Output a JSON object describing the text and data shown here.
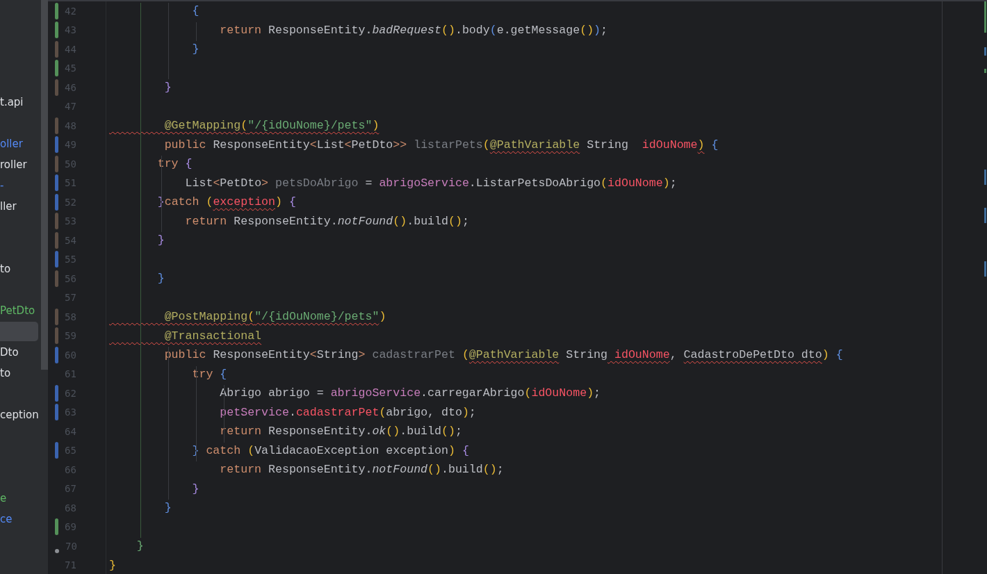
{
  "project_tree": {
    "items": [
      {
        "kind": "blank",
        "selected": false
      },
      {
        "kind": "blank",
        "selected": false
      },
      {
        "kind": "blank",
        "selected": false
      },
      {
        "kind": "blank",
        "selected": false
      },
      {
        "kind": "text",
        "label": "t.api",
        "color": "#dfe1e5",
        "selected": false
      },
      {
        "kind": "blank",
        "selected": false
      },
      {
        "kind": "text",
        "label": "oller",
        "color": "#548af7",
        "selected": false
      },
      {
        "kind": "text",
        "label": "roller",
        "color": "#dfe1e5",
        "selected": false
      },
      {
        "kind": "text",
        "label": "-",
        "color": "#548af7",
        "selected": false
      },
      {
        "kind": "text",
        "label": "ller",
        "color": "#dfe1e5",
        "selected": false
      },
      {
        "kind": "blank",
        "selected": false
      },
      {
        "kind": "blank",
        "selected": false
      },
      {
        "kind": "text",
        "label": "to",
        "color": "#dfe1e5",
        "selected": false
      },
      {
        "kind": "blank",
        "selected": false
      },
      {
        "kind": "text",
        "label": "PetDto",
        "color": "#5fb865",
        "selected": false
      },
      {
        "kind": "blank",
        "selected": true
      },
      {
        "kind": "text",
        "label": "Dto",
        "color": "#dfe1e5",
        "selected": false
      },
      {
        "kind": "text",
        "label": "to",
        "color": "#dfe1e5",
        "selected": false
      },
      {
        "kind": "blank",
        "selected": false
      },
      {
        "kind": "text",
        "label": "ception",
        "color": "#dfe1e5",
        "selected": false
      },
      {
        "kind": "blank",
        "selected": false
      },
      {
        "kind": "blank",
        "selected": false
      },
      {
        "kind": "blank",
        "selected": false
      },
      {
        "kind": "text",
        "label": "e",
        "color": "#5fb865",
        "selected": false
      },
      {
        "kind": "text",
        "label": "ce",
        "color": "#548af7",
        "selected": false
      }
    ]
  },
  "editor": {
    "lines": [
      {
        "number": "42",
        "kind": "bar",
        "color": "#549159",
        "tokens": [
          {
            "text": "            {",
            "kind": "bracket2",
            "warning": false
          }
        ]
      },
      {
        "number": "43",
        "kind": "bar",
        "color": "#549159",
        "tokens": [
          {
            "text": "                return",
            "kind": "keyword",
            "warning": false
          },
          {
            "text": " ResponseEntity.",
            "kind": "plain",
            "warning": false
          },
          {
            "text": "badRequest",
            "kind": "static",
            "warning": false
          },
          {
            "text": "()",
            "kind": "bracket1",
            "warning": false
          },
          {
            "text": ".body",
            "kind": "plain",
            "warning": false
          },
          {
            "text": "(",
            "kind": "bracket2",
            "warning": false
          },
          {
            "text": "e.getMessage",
            "kind": "plain",
            "warning": false
          },
          {
            "text": "()",
            "kind": "bracket1",
            "warning": false
          },
          {
            "text": ")",
            "kind": "bracket2",
            "warning": false
          },
          {
            "text": ";",
            "kind": "plain",
            "warning": false
          }
        ]
      },
      {
        "number": "44",
        "kind": "bar",
        "color": "#5c4e45",
        "tokens": [
          {
            "text": "            }",
            "kind": "bracket2",
            "warning": false
          }
        ]
      },
      {
        "number": "45",
        "kind": "bar",
        "color": "#549159"
      },
      {
        "number": "46",
        "kind": "bar",
        "color": "#5c4e45",
        "tokens": [
          {
            "text": "        }",
            "kind": "bracket3",
            "warning": false
          }
        ]
      },
      {
        "number": "47",
        "kind": "plain"
      },
      {
        "number": "48",
        "kind": "bar",
        "color": "#5c4e45",
        "tokens": [
          {
            "text": "        @GetMapping",
            "kind": "annotation",
            "warning": true
          },
          {
            "text": "(",
            "kind": "bracket1",
            "warning": true
          },
          {
            "text": "\"/{idOuNome}/pets\"",
            "kind": "string",
            "warning": true
          },
          {
            "text": ")",
            "kind": "bracket1",
            "warning": true
          }
        ]
      },
      {
        "number": "49",
        "kind": "bar",
        "color": "#3b64b0",
        "tokens": [
          {
            "text": "        public",
            "kind": "keyword",
            "warning": false
          },
          {
            "text": " ResponseEntity",
            "kind": "plain",
            "warning": false
          },
          {
            "text": "<",
            "kind": "keyword",
            "warning": false
          },
          {
            "text": "List",
            "kind": "plain",
            "warning": false
          },
          {
            "text": "<",
            "kind": "keyword",
            "warning": false
          },
          {
            "text": "PetDto",
            "kind": "plain",
            "warning": false
          },
          {
            "text": ">>",
            "kind": "keyword",
            "warning": false
          },
          {
            "text": " listarPets",
            "kind": "unused",
            "warning": false
          },
          {
            "text": "(",
            "kind": "bracket1",
            "warning": false
          },
          {
            "text": "@PathVariable",
            "kind": "annotation",
            "warning": true
          },
          {
            "text": " String",
            "kind": "plain",
            "warning": false
          },
          {
            "text": "  idOuNome",
            "kind": "parameter",
            "warning": false
          },
          {
            "text": ")",
            "kind": "bracket1",
            "warning": true
          },
          {
            "text": " {",
            "kind": "bracket2",
            "warning": false
          }
        ]
      },
      {
        "number": "50",
        "kind": "bar",
        "color": "#5c4e45",
        "tokens": [
          {
            "text": "       try",
            "kind": "keyword",
            "warning": false
          },
          {
            "text": " {",
            "kind": "bracket3",
            "warning": false
          }
        ]
      },
      {
        "number": "51",
        "kind": "bar",
        "color": "#3b64b0",
        "tokens": [
          {
            "text": "           List",
            "kind": "plain",
            "warning": false
          },
          {
            "text": "<",
            "kind": "keyword",
            "warning": false
          },
          {
            "text": "PetDto",
            "kind": "plain",
            "warning": false
          },
          {
            "text": ">",
            "kind": "keyword",
            "warning": false
          },
          {
            "text": " petsDoAbrigo",
            "kind": "unused",
            "warning": false
          },
          {
            "text": " = ",
            "kind": "plain",
            "warning": false
          },
          {
            "text": "abrigoService",
            "kind": "field",
            "warning": false
          },
          {
            "text": ".ListarPetsDoAbrigo",
            "kind": "plain",
            "warning": false
          },
          {
            "text": "(",
            "kind": "bracket1",
            "warning": false
          },
          {
            "text": "idOuNome",
            "kind": "parameter",
            "warning": false
          },
          {
            "text": ")",
            "kind": "bracket1",
            "warning": false
          },
          {
            "text": ";",
            "kind": "plain",
            "warning": false
          }
        ]
      },
      {
        "number": "52",
        "kind": "bar",
        "color": "#3b64b0",
        "tokens": [
          {
            "text": "       }",
            "kind": "bracket3",
            "warning": false
          },
          {
            "text": "catch",
            "kind": "keyword",
            "warning": false
          },
          {
            "text": " (",
            "kind": "bracket1",
            "warning": false
          },
          {
            "text": "exception",
            "kind": "parameter",
            "warning": true
          },
          {
            "text": ")",
            "kind": "bracket1",
            "warning": false
          },
          {
            "text": " {",
            "kind": "bracket3",
            "warning": false
          }
        ]
      },
      {
        "number": "53",
        "kind": "bar",
        "color": "#5c4e45",
        "tokens": [
          {
            "text": "           return",
            "kind": "keyword",
            "warning": false
          },
          {
            "text": " ResponseEntity.",
            "kind": "plain",
            "warning": false
          },
          {
            "text": "notFound",
            "kind": "static",
            "warning": false
          },
          {
            "text": "()",
            "kind": "bracket1",
            "warning": false
          },
          {
            "text": ".build",
            "kind": "plain",
            "warning": false
          },
          {
            "text": "()",
            "kind": "bracket1",
            "warning": false
          },
          {
            "text": ";",
            "kind": "plain",
            "warning": false
          }
        ]
      },
      {
        "number": "54",
        "kind": "bar",
        "color": "#5c4e45",
        "tokens": [
          {
            "text": "       }",
            "kind": "bracket3",
            "warning": false
          }
        ]
      },
      {
        "number": "55",
        "kind": "bar",
        "color": "#3b64b0"
      },
      {
        "number": "56",
        "kind": "bar",
        "color": "#5c4e45",
        "tokens": [
          {
            "text": "       }",
            "kind": "bracket2",
            "warning": false
          }
        ]
      },
      {
        "number": "57",
        "kind": "plain"
      },
      {
        "number": "58",
        "kind": "bar",
        "color": "#5c4e45",
        "tokens": [
          {
            "text": "        @PostMapping",
            "kind": "annotation",
            "warning": true
          },
          {
            "text": "(",
            "kind": "bracket1",
            "warning": true
          },
          {
            "text": "\"/{idOuNome}/pets\"",
            "kind": "string",
            "warning": true
          },
          {
            "text": ")",
            "kind": "bracket1",
            "warning": false
          }
        ]
      },
      {
        "number": "59",
        "kind": "bar",
        "color": "#5c4e45",
        "tokens": [
          {
            "text": "        @Transactional",
            "kind": "annotation",
            "warning": true
          }
        ]
      },
      {
        "number": "60",
        "kind": "bar",
        "color": "#3b64b0",
        "tokens": [
          {
            "text": "        public",
            "kind": "keyword",
            "warning": false
          },
          {
            "text": " ResponseEntity",
            "kind": "plain",
            "warning": false
          },
          {
            "text": "<",
            "kind": "keyword",
            "warning": false
          },
          {
            "text": "String",
            "kind": "plain",
            "warning": false
          },
          {
            "text": ">",
            "kind": "keyword",
            "warning": false
          },
          {
            "text": " cadastrarPet",
            "kind": "unused",
            "warning": false
          },
          {
            "text": " (",
            "kind": "bracket1",
            "warning": false
          },
          {
            "text": "@PathVariable",
            "kind": "annotation",
            "warning": true
          },
          {
            "text": " String",
            "kind": "plain",
            "warning": false
          },
          {
            "text": " idOuNome",
            "kind": "parameter",
            "warning": true
          },
          {
            "text": ", ",
            "kind": "plain",
            "warning": false
          },
          {
            "text": "CadastroDePetDto dto",
            "kind": "plain",
            "warning": true
          },
          {
            "text": ")",
            "kind": "bracket1",
            "warning": false
          },
          {
            "text": " {",
            "kind": "bracket2",
            "warning": false
          }
        ]
      },
      {
        "number": "61",
        "kind": "plain",
        "tokens": [
          {
            "text": "            try",
            "kind": "keyword",
            "warning": false
          },
          {
            "text": " {",
            "kind": "bracket2",
            "warning": false
          }
        ]
      },
      {
        "number": "62",
        "kind": "bar",
        "color": "#3b64b0",
        "tokens": [
          {
            "text": "                Abrigo abrigo = ",
            "kind": "plain",
            "warning": false
          },
          {
            "text": "abrigoService",
            "kind": "field",
            "warning": false
          },
          {
            "text": ".carregarAbrigo",
            "kind": "plain",
            "warning": false
          },
          {
            "text": "(",
            "kind": "bracket1",
            "warning": false
          },
          {
            "text": "idOuNome",
            "kind": "parameter",
            "warning": false
          },
          {
            "text": ")",
            "kind": "bracket1",
            "warning": false
          },
          {
            "text": ";",
            "kind": "plain",
            "warning": false
          }
        ]
      },
      {
        "number": "63",
        "kind": "bar",
        "color": "#3b64b0",
        "tokens": [
          {
            "text": "                petService",
            "kind": "field",
            "warning": false
          },
          {
            "text": ".",
            "kind": "plain",
            "warning": false
          },
          {
            "text": "cadastrarPet",
            "kind": "parameter",
            "warning": false
          },
          {
            "text": "(",
            "kind": "bracket1",
            "warning": false
          },
          {
            "text": "abrigo, dto",
            "kind": "plain",
            "warning": false
          },
          {
            "text": ")",
            "kind": "bracket1",
            "warning": false
          },
          {
            "text": ";",
            "kind": "plain",
            "warning": false
          }
        ]
      },
      {
        "number": "64",
        "kind": "plain",
        "tokens": [
          {
            "text": "                return",
            "kind": "keyword",
            "warning": false
          },
          {
            "text": " ResponseEntity.",
            "kind": "plain",
            "warning": false
          },
          {
            "text": "ok",
            "kind": "static",
            "warning": false
          },
          {
            "text": "()",
            "kind": "bracket1",
            "warning": false
          },
          {
            "text": ".build",
            "kind": "plain",
            "warning": false
          },
          {
            "text": "()",
            "kind": "bracket1",
            "warning": false
          },
          {
            "text": ";",
            "kind": "plain",
            "warning": false
          }
        ]
      },
      {
        "number": "65",
        "kind": "bar",
        "color": "#3b64b0",
        "tokens": [
          {
            "text": "            }",
            "kind": "bracket2",
            "warning": false
          },
          {
            "text": " catch",
            "kind": "keyword",
            "warning": false
          },
          {
            "text": " (",
            "kind": "bracket1",
            "warning": false
          },
          {
            "text": "ValidacaoException exception",
            "kind": "plain",
            "warning": false
          },
          {
            "text": ")",
            "kind": "bracket1",
            "warning": false
          },
          {
            "text": " {",
            "kind": "bracket3",
            "warning": false
          }
        ]
      },
      {
        "number": "66",
        "kind": "plain",
        "tokens": [
          {
            "text": "                return",
            "kind": "keyword",
            "warning": false
          },
          {
            "text": " ResponseEntity.",
            "kind": "plain",
            "warning": false
          },
          {
            "text": "notFound",
            "kind": "static",
            "warning": false
          },
          {
            "text": "()",
            "kind": "bracket1",
            "warning": false
          },
          {
            "text": ".build",
            "kind": "plain",
            "warning": false
          },
          {
            "text": "()",
            "kind": "bracket1",
            "warning": false
          },
          {
            "text": ";",
            "kind": "plain",
            "warning": false
          }
        ]
      },
      {
        "number": "67",
        "kind": "plain",
        "tokens": [
          {
            "text": "            }",
            "kind": "bracket3",
            "warning": false
          }
        ]
      },
      {
        "number": "68",
        "kind": "plain",
        "tokens": [
          {
            "text": "        }",
            "kind": "bracket2",
            "warning": false
          }
        ]
      },
      {
        "number": "69",
        "kind": "bar",
        "color": "#549159"
      },
      {
        "number": "70",
        "kind": "dot",
        "color": "#8c8f94",
        "tokens": [
          {
            "text": "    }",
            "kind": "bracket4",
            "warning": false
          }
        ]
      },
      {
        "number": "71",
        "kind": "plain",
        "tokens": [
          {
            "text": "}",
            "kind": "bracket1",
            "warning": false
          }
        ]
      }
    ]
  }
}
